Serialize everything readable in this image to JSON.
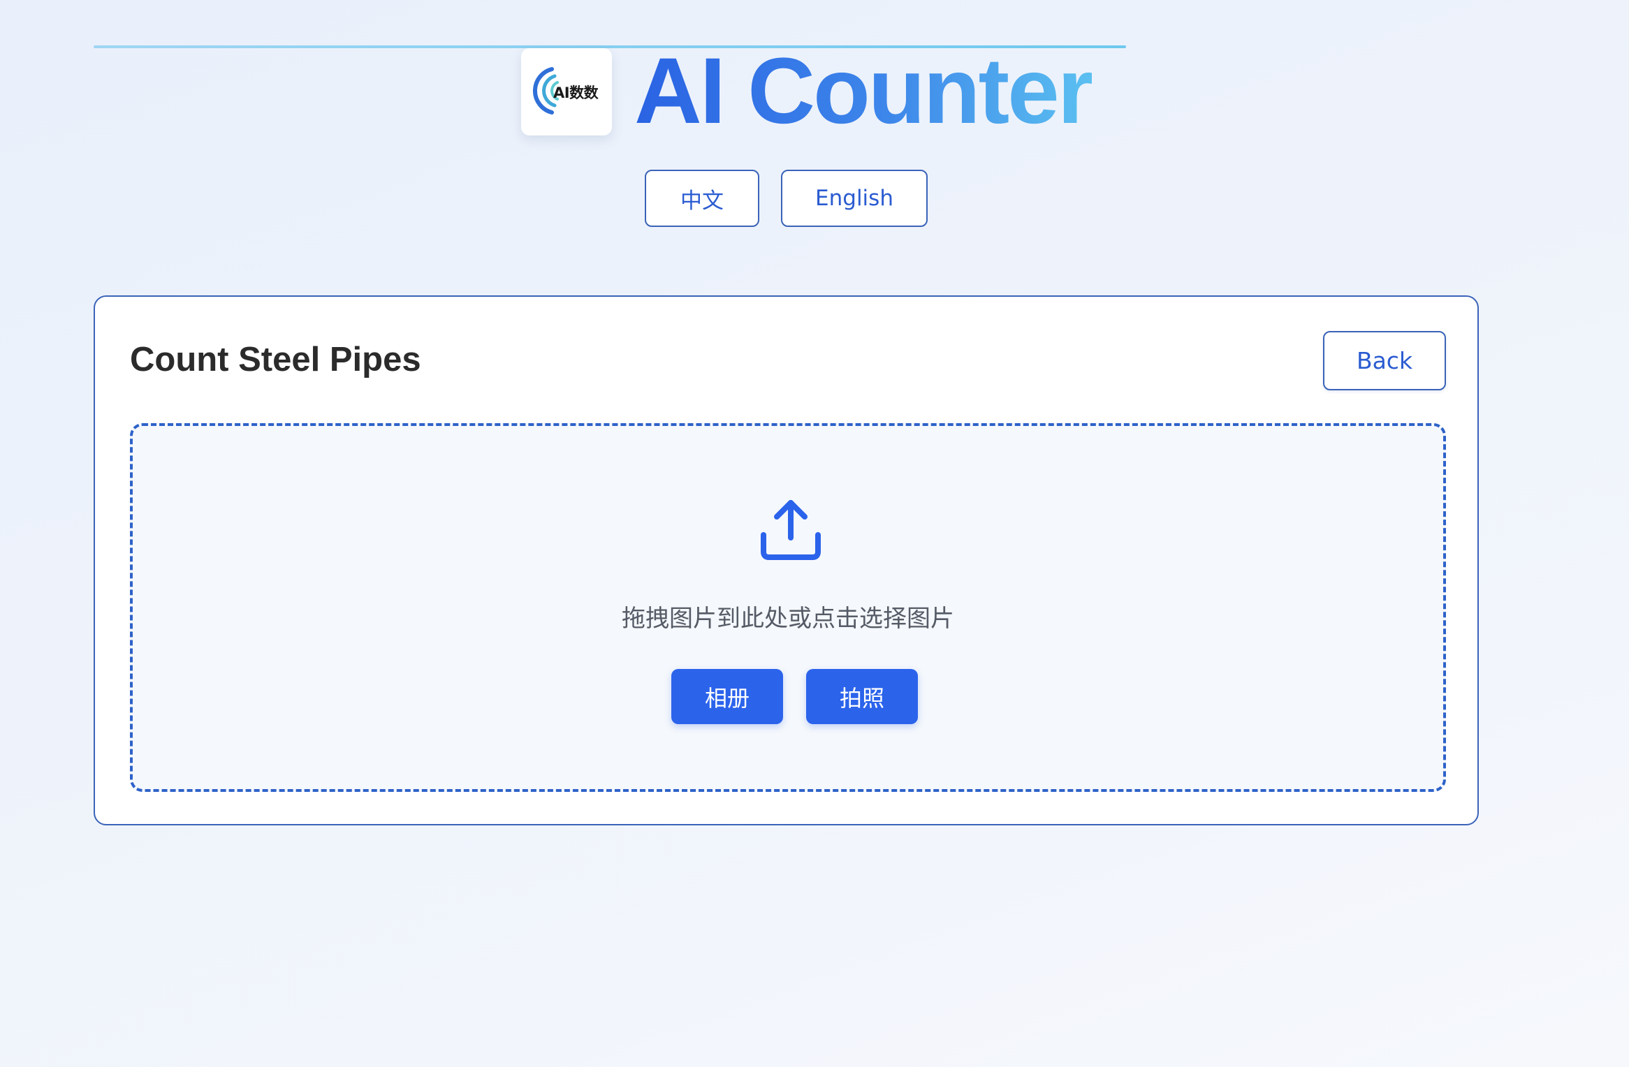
{
  "header": {
    "logo_text": "AI数数",
    "title": "AI Counter"
  },
  "language": {
    "chinese_label": "中文",
    "english_label": "English"
  },
  "card": {
    "title": "Count Steel Pipes",
    "back_label": "Back"
  },
  "upload": {
    "icon": "upload-icon",
    "hint": "拖拽图片到此处或点击选择图片",
    "album_label": "相册",
    "camera_label": "拍照"
  },
  "colors": {
    "accent": "#2b63eb",
    "border": "#3a63b8",
    "title_gradient_start": "#2a63e3",
    "title_gradient_end": "#5bc0f0"
  }
}
